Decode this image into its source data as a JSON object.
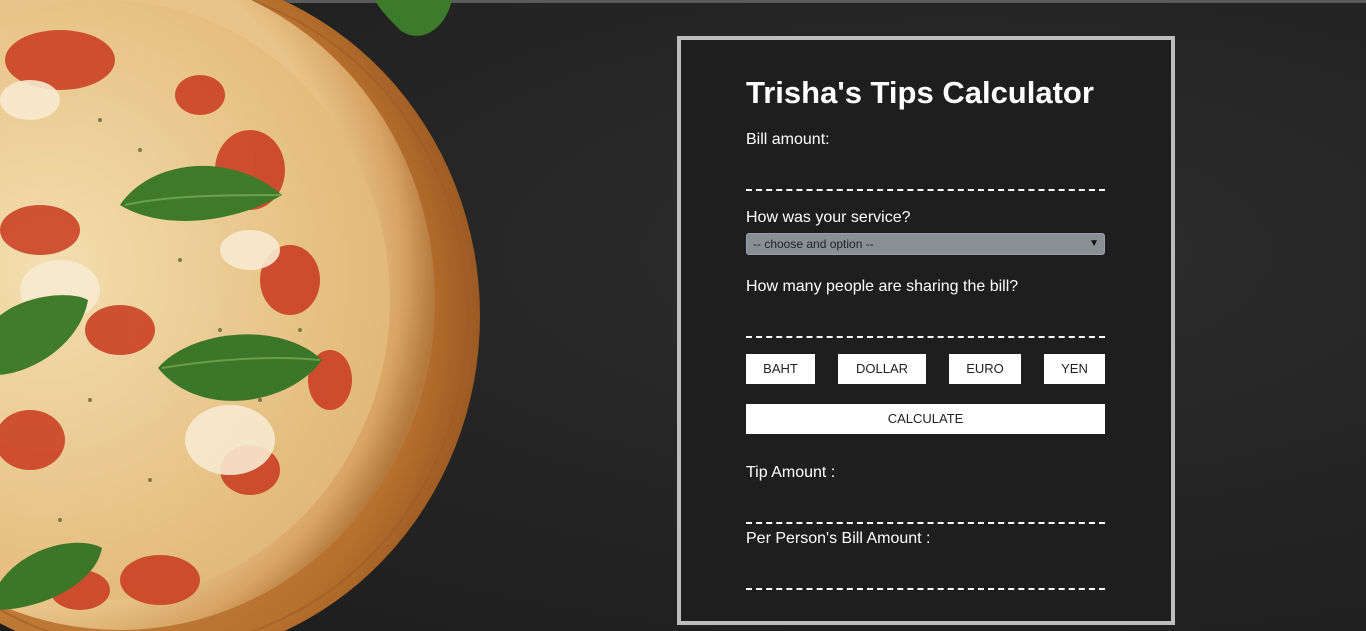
{
  "title": "Trisha's Tips Calculator",
  "bill": {
    "label": "Bill amount:",
    "value": ""
  },
  "service": {
    "label": "How was your service?",
    "selected": "-- choose and option --"
  },
  "people": {
    "label": "How many people are sharing the bill?",
    "value": ""
  },
  "currencies": [
    "BAHT",
    "DOLLAR",
    "EURO",
    "YEN"
  ],
  "calculate_label": "CALCULATE",
  "tip": {
    "label": "Tip Amount :",
    "value": ""
  },
  "per_person": {
    "label": "Per Person's Bill Amount :",
    "value": ""
  },
  "icons": {
    "select_arrow": "chevron-down-icon",
    "background": "pizza-image"
  }
}
